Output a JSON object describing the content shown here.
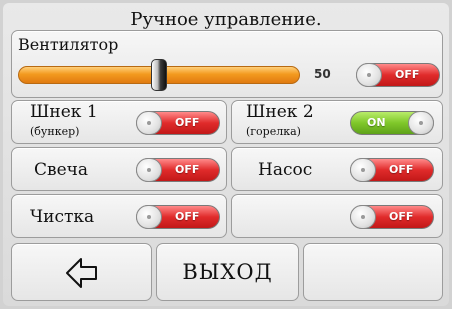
{
  "screen": {
    "title": "Ручное управление."
  },
  "fan": {
    "label": "Вентилятор",
    "value": "50",
    "level": 0.5,
    "toggle": "OFF"
  },
  "rows": [
    {
      "label": "Шнек 1",
      "sublabel": "(бункер)",
      "toggle": "OFF"
    },
    {
      "label": "Шнек 2",
      "sublabel": "(горелка)",
      "toggle": "ON"
    },
    {
      "label": "Свеча",
      "toggle": "OFF"
    },
    {
      "label": "Насос",
      "toggle": "OFF"
    },
    {
      "label": "Чистка",
      "toggle": "OFF"
    },
    {
      "label": "",
      "toggle": "OFF"
    }
  ],
  "footer": {
    "back_icon": "arrow-left-icon",
    "exit_label": "ВЫХОД",
    "empty_label": ""
  },
  "colors": {
    "toggle_off": "#e02b2b",
    "toggle_on": "#7fc72a",
    "slider": "#f39a1f"
  }
}
